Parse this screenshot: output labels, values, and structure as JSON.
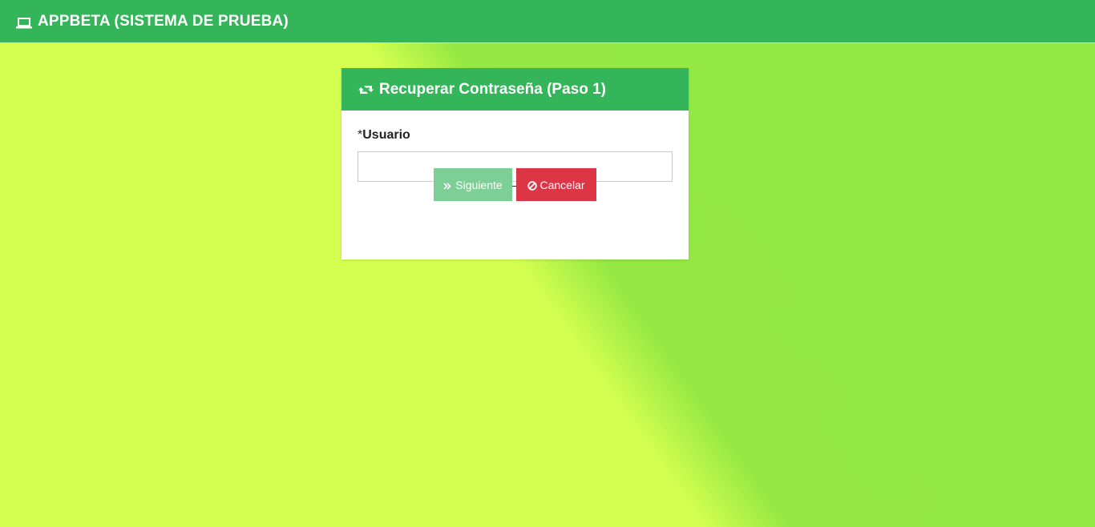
{
  "navbar": {
    "brand_icon": "laptop-icon",
    "brand_label": "APPBETA (SISTEMA DE PRUEBA)"
  },
  "panel": {
    "heading_icon": "retweet-icon",
    "title": "Recuperar Contraseña (Paso 1)",
    "field": {
      "required_mark": "*",
      "label": "Usuario",
      "value": "",
      "placeholder": ""
    },
    "buttons": {
      "next_icon": "double-chevron-right-icon",
      "next_label": "Siguiente",
      "cancel_icon": "ban-icon",
      "cancel_label": "Cancelar"
    }
  },
  "colors": {
    "header": "#34b55a",
    "background_light": "#d4ff50",
    "background_green": "#93e844",
    "next_button": "#7dcf95",
    "cancel_button": "#dc3545"
  }
}
